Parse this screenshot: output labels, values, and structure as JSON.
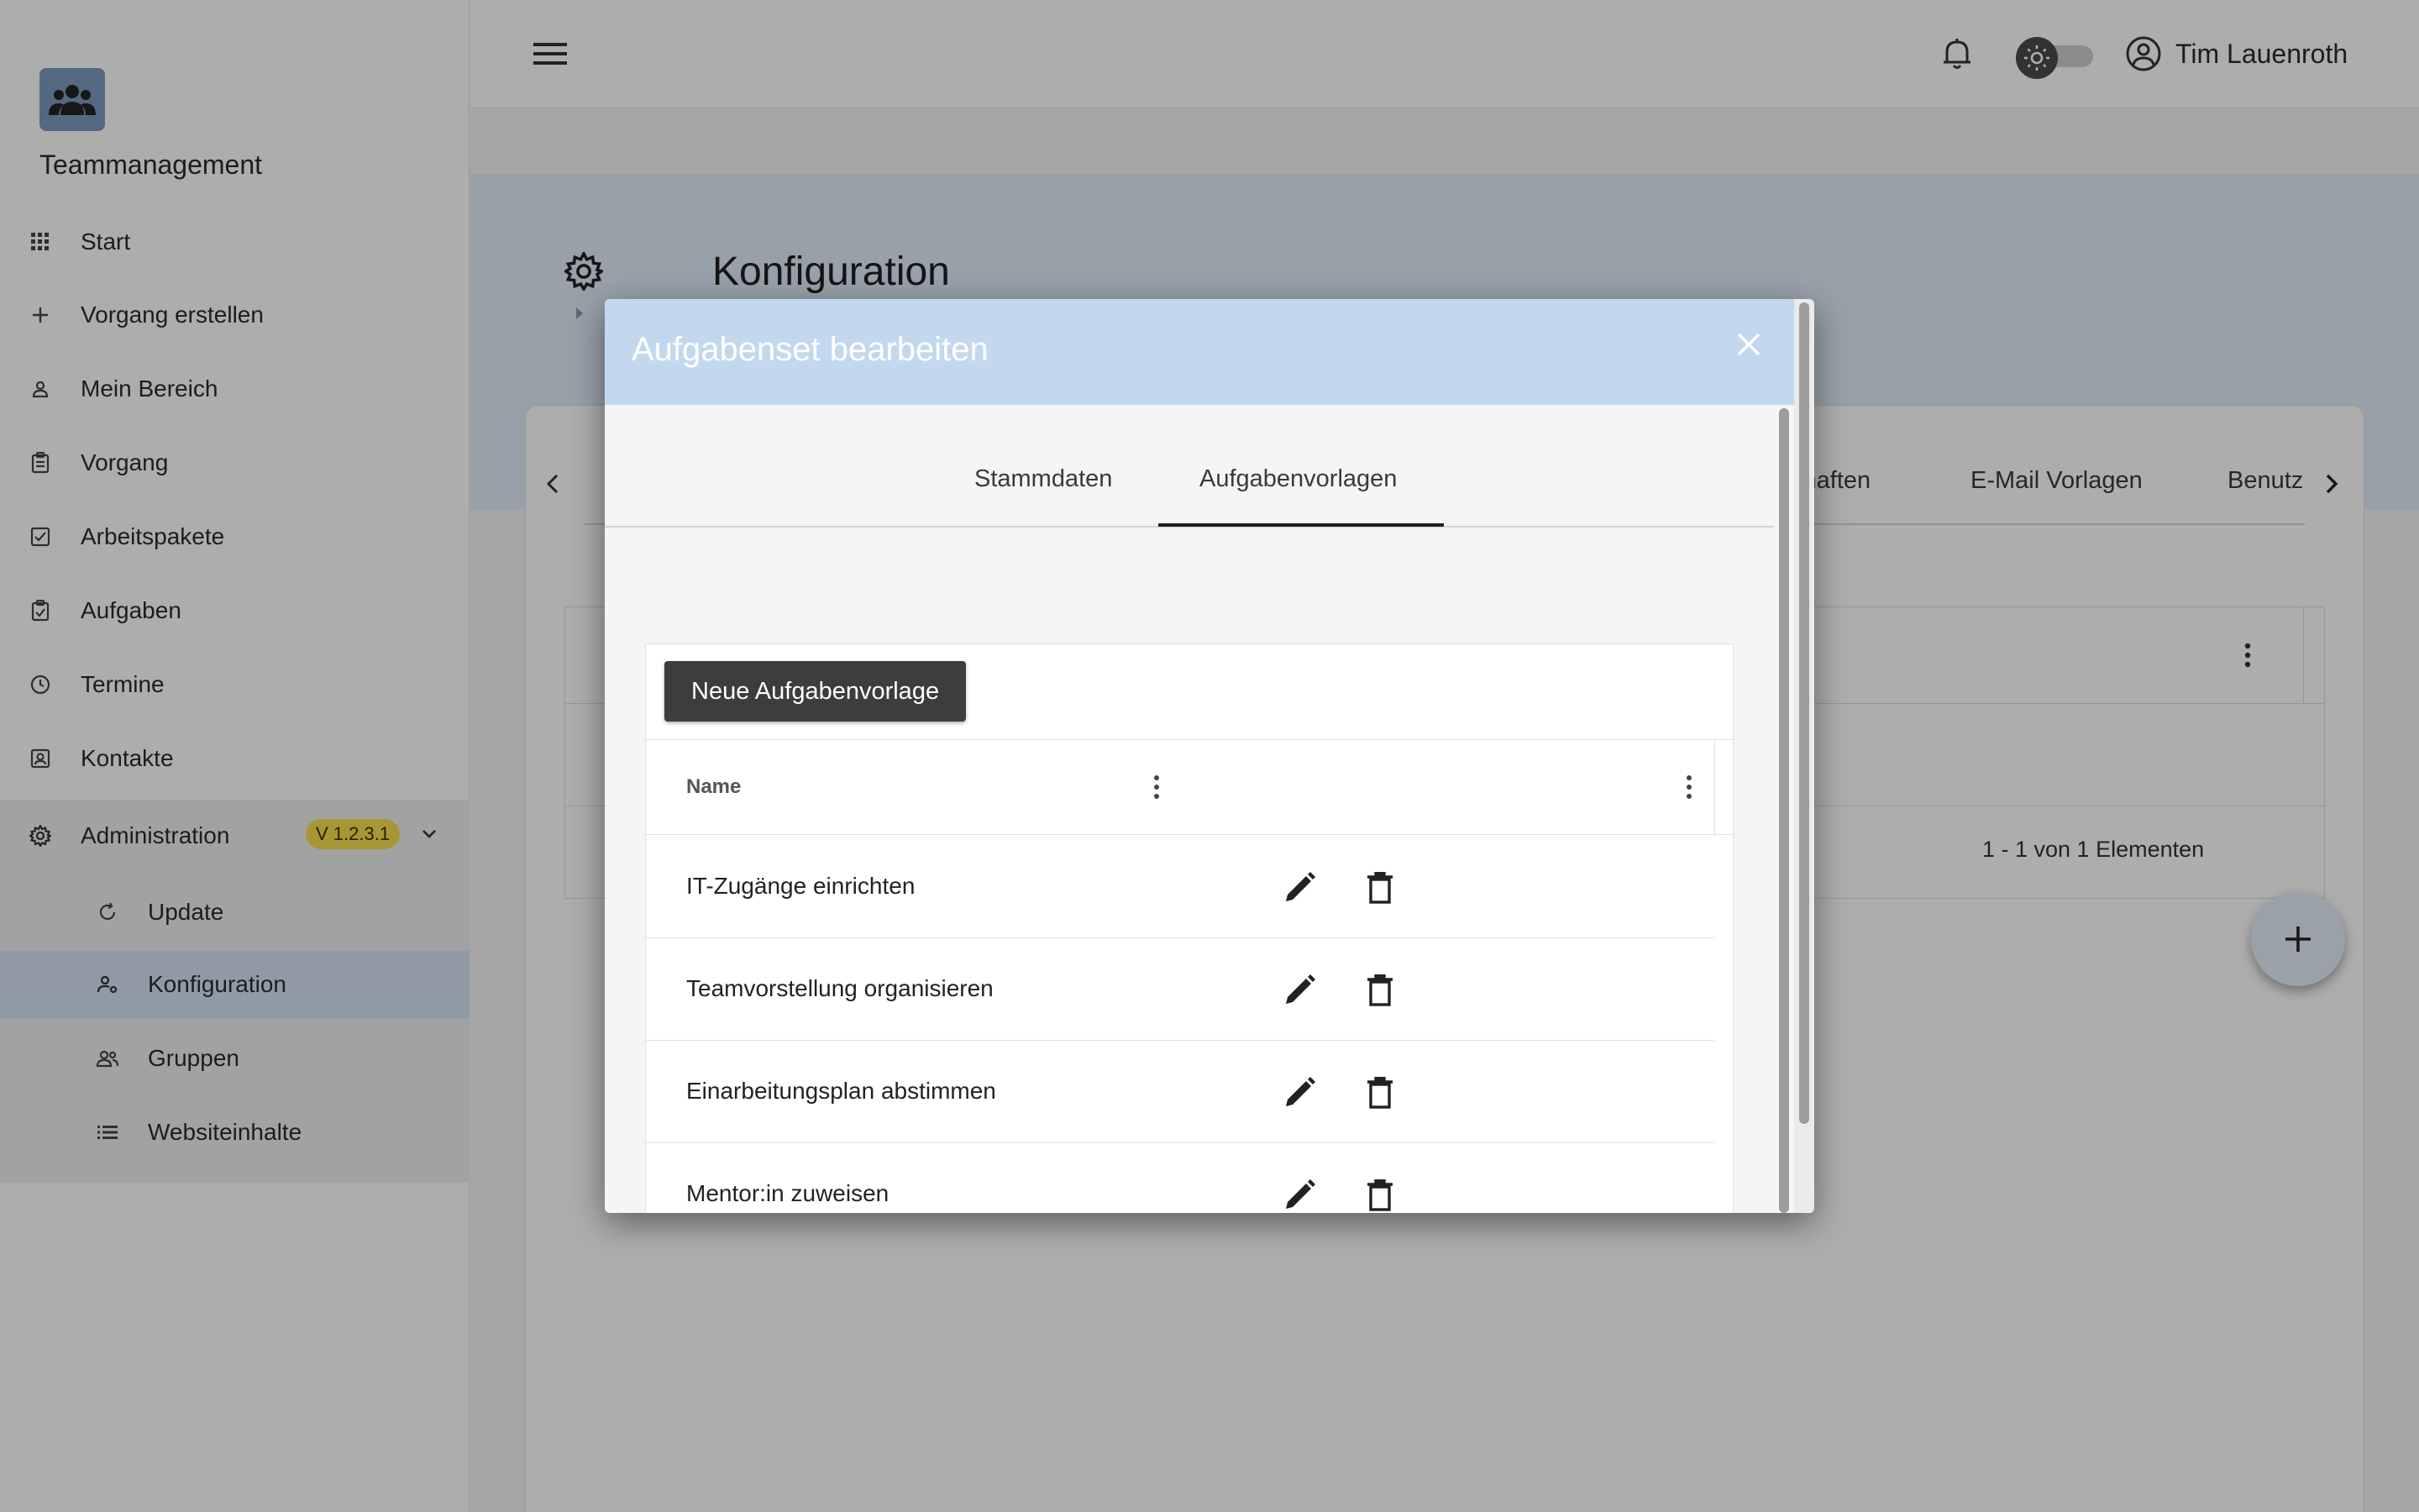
{
  "app": {
    "title": "Teammanagement",
    "user_name": "Tim Lauenroth",
    "version": "V 1.2.3.1"
  },
  "sidebar": {
    "items": [
      {
        "label": "Start",
        "icon": "apps-grid-icon"
      },
      {
        "label": "Vorgang erstellen",
        "icon": "plus-icon"
      },
      {
        "label": "Mein Bereich",
        "icon": "person-icon"
      },
      {
        "label": "Vorgang",
        "icon": "clipboard-icon"
      },
      {
        "label": "Arbeitspakete",
        "icon": "checkbox-icon"
      },
      {
        "label": "Aufgaben",
        "icon": "task-check-icon"
      },
      {
        "label": "Termine",
        "icon": "clock-icon"
      },
      {
        "label": "Kontakte",
        "icon": "contact-card-icon"
      }
    ],
    "admin": {
      "label": "Administration",
      "sub_items": [
        {
          "label": "Update",
          "icon": "refresh-icon"
        },
        {
          "label": "Konfiguration",
          "icon": "person-settings-icon",
          "active": true
        },
        {
          "label": "Gruppen",
          "icon": "group-icon"
        },
        {
          "label": "Websiteinhalte",
          "icon": "list-icon"
        }
      ]
    }
  },
  "page": {
    "title": "Konfiguration",
    "bg_tabs": [
      "chaften",
      "E-Mail Vorlagen",
      "Benutz"
    ],
    "paging": "1 - 1 von 1 Elementen"
  },
  "dialog": {
    "title": "Aufgabenset bearbeiten",
    "tabs": [
      {
        "label": "Stammdaten",
        "active": false
      },
      {
        "label": "Aufgabenvorlagen",
        "active": true
      }
    ],
    "new_button": "Neue Aufgabenvorlage",
    "column_name": "Name",
    "rows": [
      {
        "name": "IT-Zugänge einrichten"
      },
      {
        "name": "Teamvorstellung organisieren"
      },
      {
        "name": "Einarbeitungsplan abstimmen"
      },
      {
        "name": "Mentor:in zuweisen"
      }
    ]
  },
  "colors": {
    "header_band": "#e1ecfa",
    "dialog_header": "#c3d8ef",
    "active_nav": "#d4e3f6",
    "version_badge": "#f5df4d",
    "primary_button": "#3d3d3d"
  }
}
